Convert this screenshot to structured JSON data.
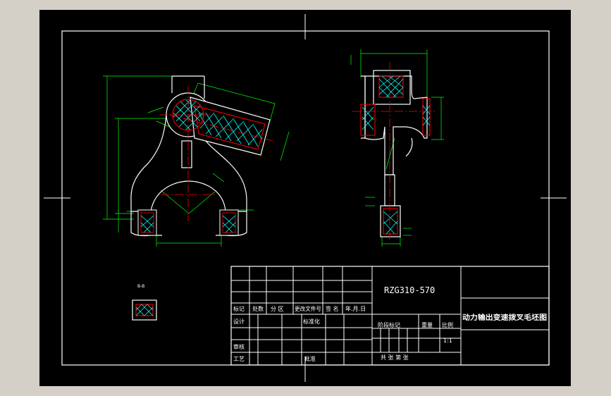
{
  "colors": {
    "background": "#d4d0c8",
    "sheet": "#000000",
    "outline": "#ffffff",
    "dimension": "#00ff00",
    "centerline": "#ff0000",
    "hatch": "#00ffff"
  },
  "title_block": {
    "drawing_number": "RZG310-570",
    "part_name": "动力输出变速拨叉毛坯图",
    "scale_value": "1:1",
    "label_mark": "标记",
    "label_count": "处数",
    "label_zone": "分 区",
    "label_change_doc": "更改文件号",
    "label_sign": "签 名",
    "label_date": "年.月.日",
    "label_design": "设计",
    "label_standardize": "标准化",
    "label_stage_mark": "阶段标记",
    "label_weight": "重量",
    "label_scale": "比例",
    "label_review": "审核",
    "label_process": "工艺",
    "label_approve": "批准",
    "label_sheets": "共   张  第   张"
  },
  "section_label": "B-B"
}
